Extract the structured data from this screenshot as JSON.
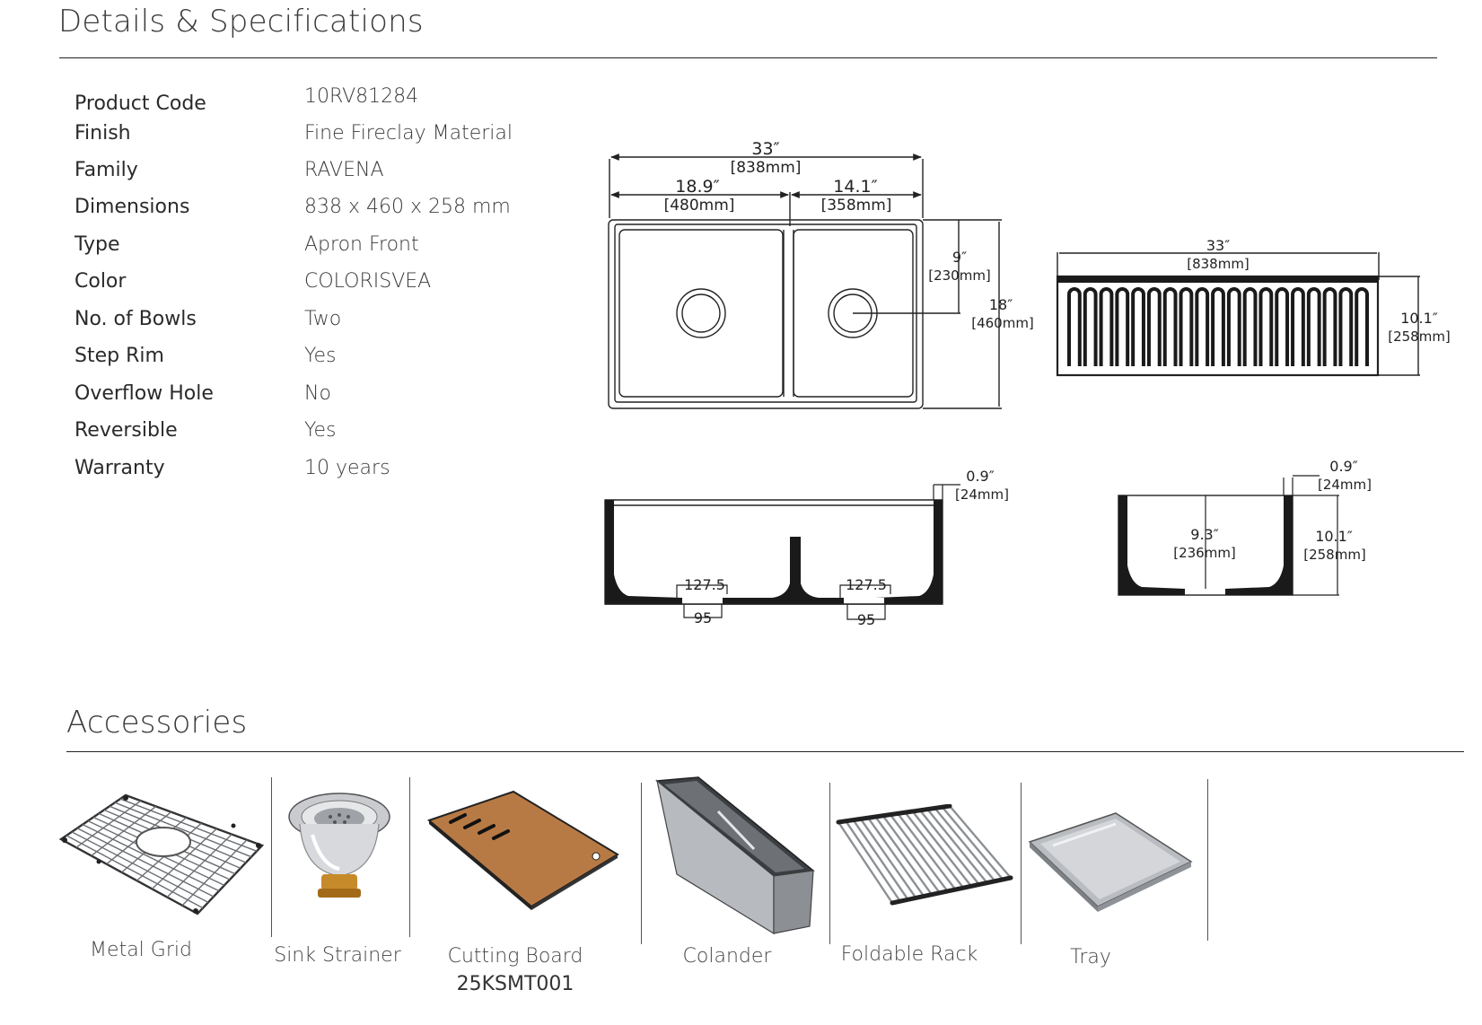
{
  "details": {
    "title": "Details & Specifications",
    "specs": [
      {
        "label": "Product Code",
        "value": "10RV81284"
      },
      {
        "label": "Finish",
        "value": "Fine Fireclay Material"
      },
      {
        "label": "Family",
        "value": "RAVENA"
      },
      {
        "label": "Dimensions",
        "value": "838 x 460 x 258 mm"
      },
      {
        "label": "Type",
        "value": "Apron Front"
      },
      {
        "label": "Color",
        "value": "COLORISVEA"
      },
      {
        "label": "No. of Bowls",
        "value": "Two"
      },
      {
        "label": "Step Rim",
        "value": "Yes"
      },
      {
        "label": "Overflow Hole",
        "value": "No"
      },
      {
        "label": "Reversible",
        "value": "Yes"
      },
      {
        "label": "Warranty",
        "value": "10 years"
      }
    ]
  },
  "drawings": {
    "top_view": {
      "overall_in": "33″",
      "overall_mm": "[838mm]",
      "left_in": "18.9″",
      "left_mm": "[480mm]",
      "right_in": "14.1″",
      "right_mm": "[358mm]",
      "depth_bowl_in": "9″",
      "depth_bowl_mm": "[230mm]",
      "depth_in": "18″",
      "depth_mm": "[460mm]"
    },
    "front_view": {
      "width_in": "33″",
      "width_mm": "[838mm]",
      "height_in": "10.1″",
      "height_mm": "[258mm]"
    },
    "section_long": {
      "rim_in": "0.9″",
      "rim_mm": "[24mm]",
      "drain_left_top": "127.5",
      "drain_left_bottom": "95",
      "drain_right_top": "127.5",
      "drain_right_bottom": "95"
    },
    "section_side": {
      "rim_in": "0.9″",
      "rim_mm": "[24mm]",
      "inner_in": "9.3″",
      "inner_mm": "[236mm]",
      "height_in": "10.1″",
      "height_mm": "[258mm]"
    }
  },
  "accessories": {
    "title": "Accessories",
    "items": [
      {
        "label": "Metal Grid",
        "icon": "metal-grid-icon"
      },
      {
        "label": "Sink Strainer",
        "icon": "sink-strainer-icon"
      },
      {
        "label": "Cutting Board",
        "code": "25KSMT001",
        "icon": "cutting-board-icon"
      },
      {
        "label": "Colander",
        "icon": "colander-icon"
      },
      {
        "label": "Foldable Rack",
        "icon": "foldable-rack-icon"
      },
      {
        "label": "Tray",
        "icon": "tray-icon"
      }
    ]
  },
  "colors": {
    "rule": "#222222",
    "wood": "#b87a45",
    "steel": "#9a9da2",
    "line": "#222222"
  }
}
